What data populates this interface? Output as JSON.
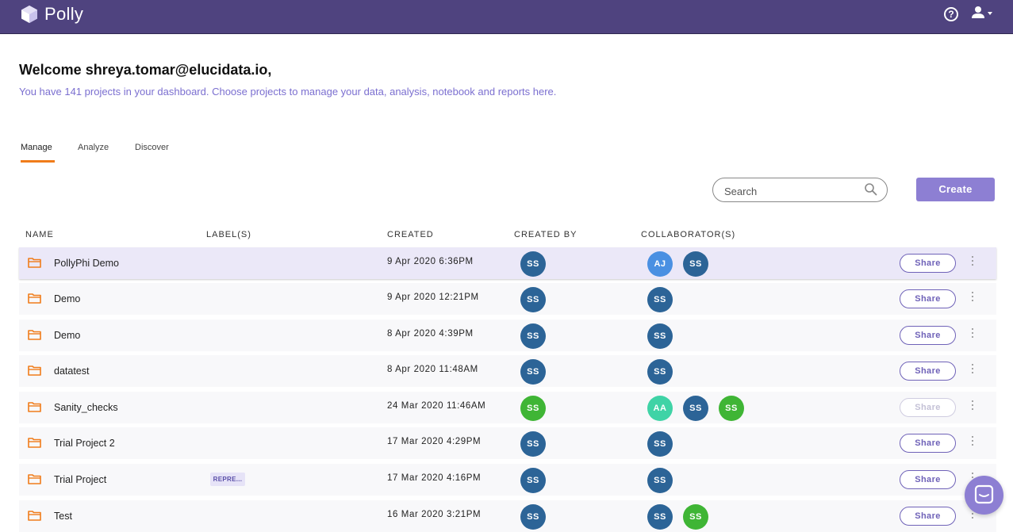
{
  "app": {
    "brand": "Polly"
  },
  "header": {
    "help_glyph": "?"
  },
  "welcome": {
    "title": "Welcome shreya.tomar@elucidata.io,",
    "subtitle": "You have 141 projects in your dashboard. Choose projects to manage your data, analysis, notebook and reports here."
  },
  "tabs": [
    {
      "label": "Manage",
      "active": true
    },
    {
      "label": "Analyze",
      "active": false
    },
    {
      "label": "Discover",
      "active": false
    }
  ],
  "search": {
    "placeholder": "Search",
    "value": ""
  },
  "create_label": "Create",
  "columns": {
    "name": "NAME",
    "labels": "LABEL(S)",
    "created": "CREATED",
    "created_by": "CREATED BY",
    "collaborators": "COLLABORATOR(S)"
  },
  "share_label": "Share",
  "colors": {
    "header_bg": "#4f437f",
    "accent": "#8d7fd3",
    "tab_underline": "#f07c1a",
    "folder": "#f07c1a",
    "avatar_blue": "#2c6497",
    "avatar_green": "#3fb535",
    "avatar_light_blue": "#4a90e2",
    "avatar_teal": "#3fd3a6"
  },
  "projects": [
    {
      "name": "PollyPhi Demo",
      "label": "",
      "created": "9 Apr 2020 6:36PM",
      "created_by": {
        "initials": "SS",
        "color": "#2c6497"
      },
      "collaborators": [
        {
          "initials": "AJ",
          "color": "#4a90e2"
        },
        {
          "initials": "SS",
          "color": "#2c6497"
        }
      ],
      "share_enabled": true,
      "highlighted": true
    },
    {
      "name": "Demo",
      "label": "",
      "created": "9 Apr 2020 12:21PM",
      "created_by": {
        "initials": "SS",
        "color": "#2c6497"
      },
      "collaborators": [
        {
          "initials": "SS",
          "color": "#2c6497"
        }
      ],
      "share_enabled": true,
      "highlighted": false
    },
    {
      "name": "Demo",
      "label": "",
      "created": "8 Apr 2020 4:39PM",
      "created_by": {
        "initials": "SS",
        "color": "#2c6497"
      },
      "collaborators": [
        {
          "initials": "SS",
          "color": "#2c6497"
        }
      ],
      "share_enabled": true,
      "highlighted": false
    },
    {
      "name": "datatest",
      "label": "",
      "created": "8 Apr 2020 11:48AM",
      "created_by": {
        "initials": "SS",
        "color": "#2c6497"
      },
      "collaborators": [
        {
          "initials": "SS",
          "color": "#2c6497"
        }
      ],
      "share_enabled": true,
      "highlighted": false
    },
    {
      "name": "Sanity_checks",
      "label": "",
      "created": "24 Mar 2020 11:46AM",
      "created_by": {
        "initials": "SS",
        "color": "#3fb535"
      },
      "collaborators": [
        {
          "initials": "AA",
          "color": "#3fd3a6"
        },
        {
          "initials": "SS",
          "color": "#2c6497"
        },
        {
          "initials": "SS",
          "color": "#3fb535"
        }
      ],
      "share_enabled": false,
      "highlighted": false
    },
    {
      "name": "Trial Project 2",
      "label": "",
      "created": "17 Mar 2020 4:29PM",
      "created_by": {
        "initials": "SS",
        "color": "#2c6497"
      },
      "collaborators": [
        {
          "initials": "SS",
          "color": "#2c6497"
        }
      ],
      "share_enabled": true,
      "highlighted": false
    },
    {
      "name": "Trial Project",
      "label": "REPRE...",
      "created": "17 Mar 2020 4:16PM",
      "created_by": {
        "initials": "SS",
        "color": "#2c6497"
      },
      "collaborators": [
        {
          "initials": "SS",
          "color": "#2c6497"
        }
      ],
      "share_enabled": true,
      "highlighted": false
    },
    {
      "name": "Test",
      "label": "",
      "created": "16 Mar 2020 3:21PM",
      "created_by": {
        "initials": "SS",
        "color": "#2c6497"
      },
      "collaborators": [
        {
          "initials": "SS",
          "color": "#2c6497"
        },
        {
          "initials": "SS",
          "color": "#3fb535"
        }
      ],
      "share_enabled": true,
      "highlighted": false
    }
  ]
}
